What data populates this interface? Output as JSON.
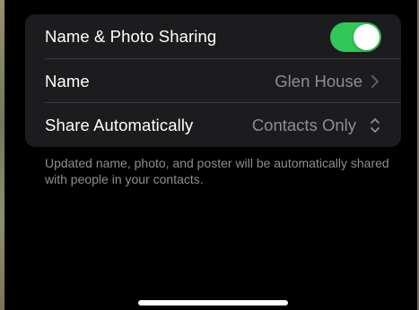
{
  "settings": {
    "rows": {
      "sharing": {
        "label": "Name & Photo Sharing",
        "toggle_on": true,
        "toggle_color": "#31c759"
      },
      "name": {
        "label": "Name",
        "value": "Glen House",
        "accessory_icon": "chevron-right-icon"
      },
      "share_auto": {
        "label": "Share Automatically",
        "value": "Contacts Only",
        "accessory_icon": "chevron-up-down-icon"
      }
    },
    "footer": "Updated name, photo, and poster will be automatically shared with people in your contacts."
  }
}
